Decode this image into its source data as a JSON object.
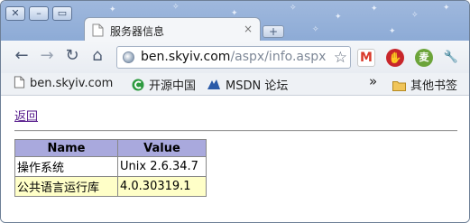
{
  "tab": {
    "title": "服务器信息",
    "close": "×"
  },
  "window_buttons": {
    "minimize": "–",
    "maximize": "▭",
    "close": "✕"
  },
  "new_tab": "+",
  "nav": {
    "back": "←",
    "forward": "→",
    "reload": "↻",
    "home": "⌂"
  },
  "omnibox": {
    "host": "ben.skyiv.com",
    "path": "/aspx/info.aspx",
    "star": "☆"
  },
  "extensions": [
    {
      "name": "gmail-icon",
      "label": "M",
      "color": "#d93a2b"
    },
    {
      "name": "adblock-icon",
      "label": "✋",
      "color": "#c8262b"
    },
    {
      "name": "extension-circle-icon",
      "label": "麦",
      "color": "#6ca43a"
    },
    {
      "name": "wrench-icon",
      "label": "🔧",
      "color": "#5a6a80"
    }
  ],
  "bookmarks": [
    {
      "label": "ben.skyiv.com"
    },
    {
      "label": "开源中国"
    },
    {
      "label": "MSDN 论坛"
    }
  ],
  "bookmarks_overflow": "»",
  "other_bookmarks": "其他书签",
  "page": {
    "back_link": "返回",
    "table": {
      "headers": [
        "Name",
        "Value"
      ],
      "rows": [
        [
          "操作系统",
          "Unix 2.6.34.7"
        ],
        [
          "公共语言运行库",
          "4.0.30319.1"
        ]
      ]
    }
  }
}
